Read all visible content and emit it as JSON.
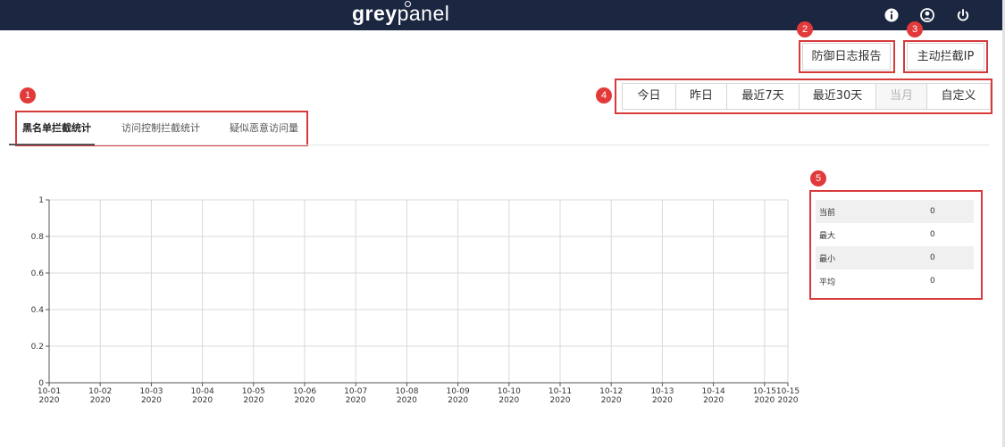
{
  "header": {
    "logo_bold": "grey",
    "logo_light": "panel",
    "icons": [
      "info-icon",
      "user-icon",
      "power-icon"
    ]
  },
  "actions": {
    "defense_report_label": "防御日志报告",
    "block_ip_label": "主动拦截IP"
  },
  "date_range": {
    "options": [
      {
        "label": "今日",
        "disabled": false
      },
      {
        "label": "昨日",
        "disabled": false
      },
      {
        "label": "最近7天",
        "disabled": false
      },
      {
        "label": "最近30天",
        "disabled": false
      },
      {
        "label": "当月",
        "disabled": true
      },
      {
        "label": "自定义",
        "disabled": false
      }
    ]
  },
  "tabs": [
    {
      "label": "黑名单拦截统计",
      "active": true
    },
    {
      "label": "访问控制拦截统计",
      "active": false
    },
    {
      "label": "疑似恶意访问量",
      "active": false
    }
  ],
  "annotations": [
    "1",
    "2",
    "3",
    "4",
    "5"
  ],
  "colors": {
    "topbar": "#1b2640",
    "annotation": "#e23a3a",
    "grid": "#d9d9d9"
  },
  "chart_data": {
    "type": "line",
    "title": "",
    "xlabel": "",
    "ylabel": "",
    "ylim": [
      0,
      1
    ],
    "y_ticks": [
      "0",
      "0.2",
      "0.4",
      "0.6",
      "0.8",
      "1"
    ],
    "x_ticks": [
      {
        "date": "10-01",
        "year": "2020"
      },
      {
        "date": "10-02",
        "year": "2020"
      },
      {
        "date": "10-03",
        "year": "2020"
      },
      {
        "date": "10-04",
        "year": "2020"
      },
      {
        "date": "10-05",
        "year": "2020"
      },
      {
        "date": "10-06",
        "year": "2020"
      },
      {
        "date": "10-07",
        "year": "2020"
      },
      {
        "date": "10-08",
        "year": "2020"
      },
      {
        "date": "10-09",
        "year": "2020"
      },
      {
        "date": "10-10",
        "year": "2020"
      },
      {
        "date": "10-11",
        "year": "2020"
      },
      {
        "date": "10-12",
        "year": "2020"
      },
      {
        "date": "10-13",
        "year": "2020"
      },
      {
        "date": "10-14",
        "year": "2020"
      },
      {
        "date": "10-15",
        "year": "2020"
      },
      {
        "date": "10-15",
        "year": "2020"
      }
    ],
    "grid": true,
    "series": []
  },
  "stats": [
    {
      "label": "当前",
      "value": "0"
    },
    {
      "label": "最大",
      "value": "0"
    },
    {
      "label": "最小",
      "value": "0"
    },
    {
      "label": "平均",
      "value": "0"
    }
  ]
}
